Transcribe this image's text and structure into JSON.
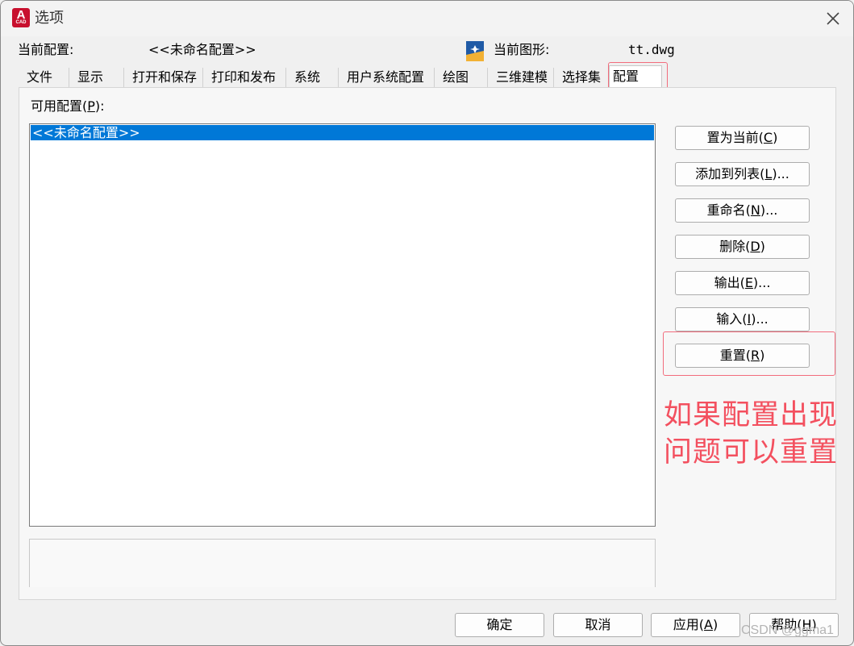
{
  "window": {
    "title": "选项",
    "app_icon_letter": "A",
    "app_icon_sub": "CAD"
  },
  "info": {
    "current_profile_label": "当前配置:",
    "current_profile_value": "<<未命名配置>>",
    "current_drawing_label": "当前图形:",
    "current_drawing_value": "tt.dwg"
  },
  "tabs": [
    {
      "label": "文件"
    },
    {
      "label": "显示"
    },
    {
      "label": "打开和保存"
    },
    {
      "label": "打印和发布"
    },
    {
      "label": "系统"
    },
    {
      "label": "用户系统配置"
    },
    {
      "label": "绘图"
    },
    {
      "label": "三维建模"
    },
    {
      "label": "选择集"
    },
    {
      "label": "配置",
      "active": true
    }
  ],
  "profiles": {
    "label_prefix": "可用配置(",
    "label_key": "P",
    "label_suffix": "):",
    "items": [
      "<<未命名配置>>"
    ],
    "description": ""
  },
  "buttons": [
    {
      "prefix": "置为当前(",
      "key": "C",
      "suffix": ")"
    },
    {
      "prefix": "添加到列表(",
      "key": "L",
      "suffix": ")..."
    },
    {
      "prefix": "重命名(",
      "key": "N",
      "suffix": ")..."
    },
    {
      "prefix": "删除(",
      "key": "D",
      "suffix": ")"
    },
    {
      "prefix": "输出(",
      "key": "E",
      "suffix": ")..."
    },
    {
      "prefix": "输入(",
      "key": "I",
      "suffix": ")..."
    },
    {
      "prefix": "重置(",
      "key": "R",
      "suffix": ")"
    }
  ],
  "annotation": {
    "line1": "如果配置出现",
    "line2": "问题可以重置",
    "color": "#f3505f"
  },
  "footer": {
    "ok": "确定",
    "cancel": "取消",
    "apply_prefix": "应用(",
    "apply_key": "A",
    "apply_suffix": ")",
    "help_prefix": "帮助(",
    "help_key": "H",
    "help_suffix": ")"
  },
  "watermark": "CSDN @ggma1",
  "colors": {
    "selection": "#0078d7",
    "highlight_box": "#f26d7d",
    "app_icon": "#c8102e"
  }
}
